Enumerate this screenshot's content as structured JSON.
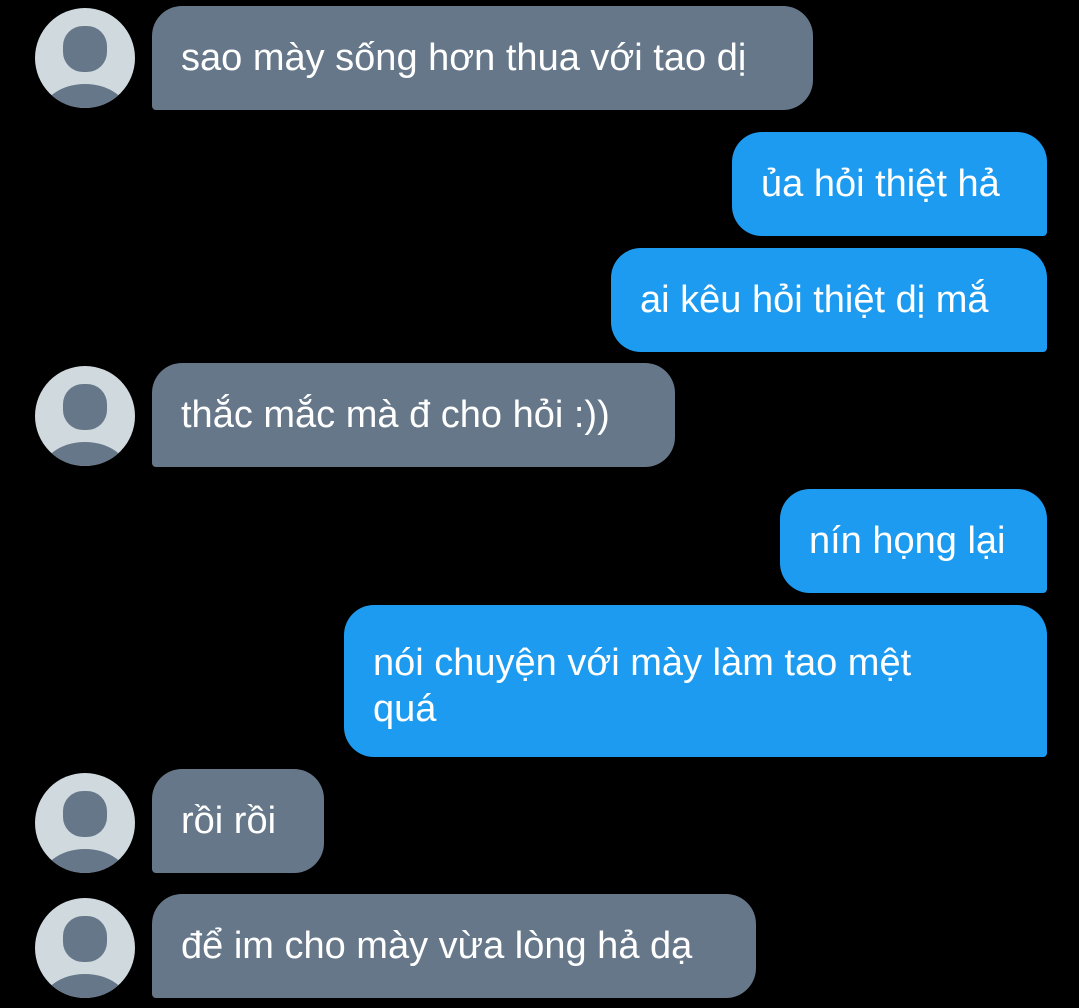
{
  "conversation": {
    "messages": [
      {
        "sender": "other",
        "text": "sao mày sống hơn thua với tao dị"
      },
      {
        "sender": "me",
        "text": "ủa hỏi thiệt hả"
      },
      {
        "sender": "me",
        "text": "ai kêu hỏi thiệt dị mắ"
      },
      {
        "sender": "other",
        "text": "thắc mắc mà đ cho hỏi :))"
      },
      {
        "sender": "me",
        "text": "nín họng lại"
      },
      {
        "sender": "me",
        "text": "nói chuyện với mày làm tao mệt quá"
      },
      {
        "sender": "other",
        "text": "rồi rồi"
      },
      {
        "sender": "other",
        "text": "để im cho mày vừa lòng hả dạ"
      }
    ]
  },
  "colors": {
    "background": "#000000",
    "incoming_bubble": "#66778a",
    "outgoing_bubble": "#1d9bf0",
    "avatar_bg": "#cfd9de",
    "avatar_figure": "#66778a",
    "text": "#ffffff"
  },
  "icons": {
    "avatar": "default-profile-avatar-icon"
  }
}
